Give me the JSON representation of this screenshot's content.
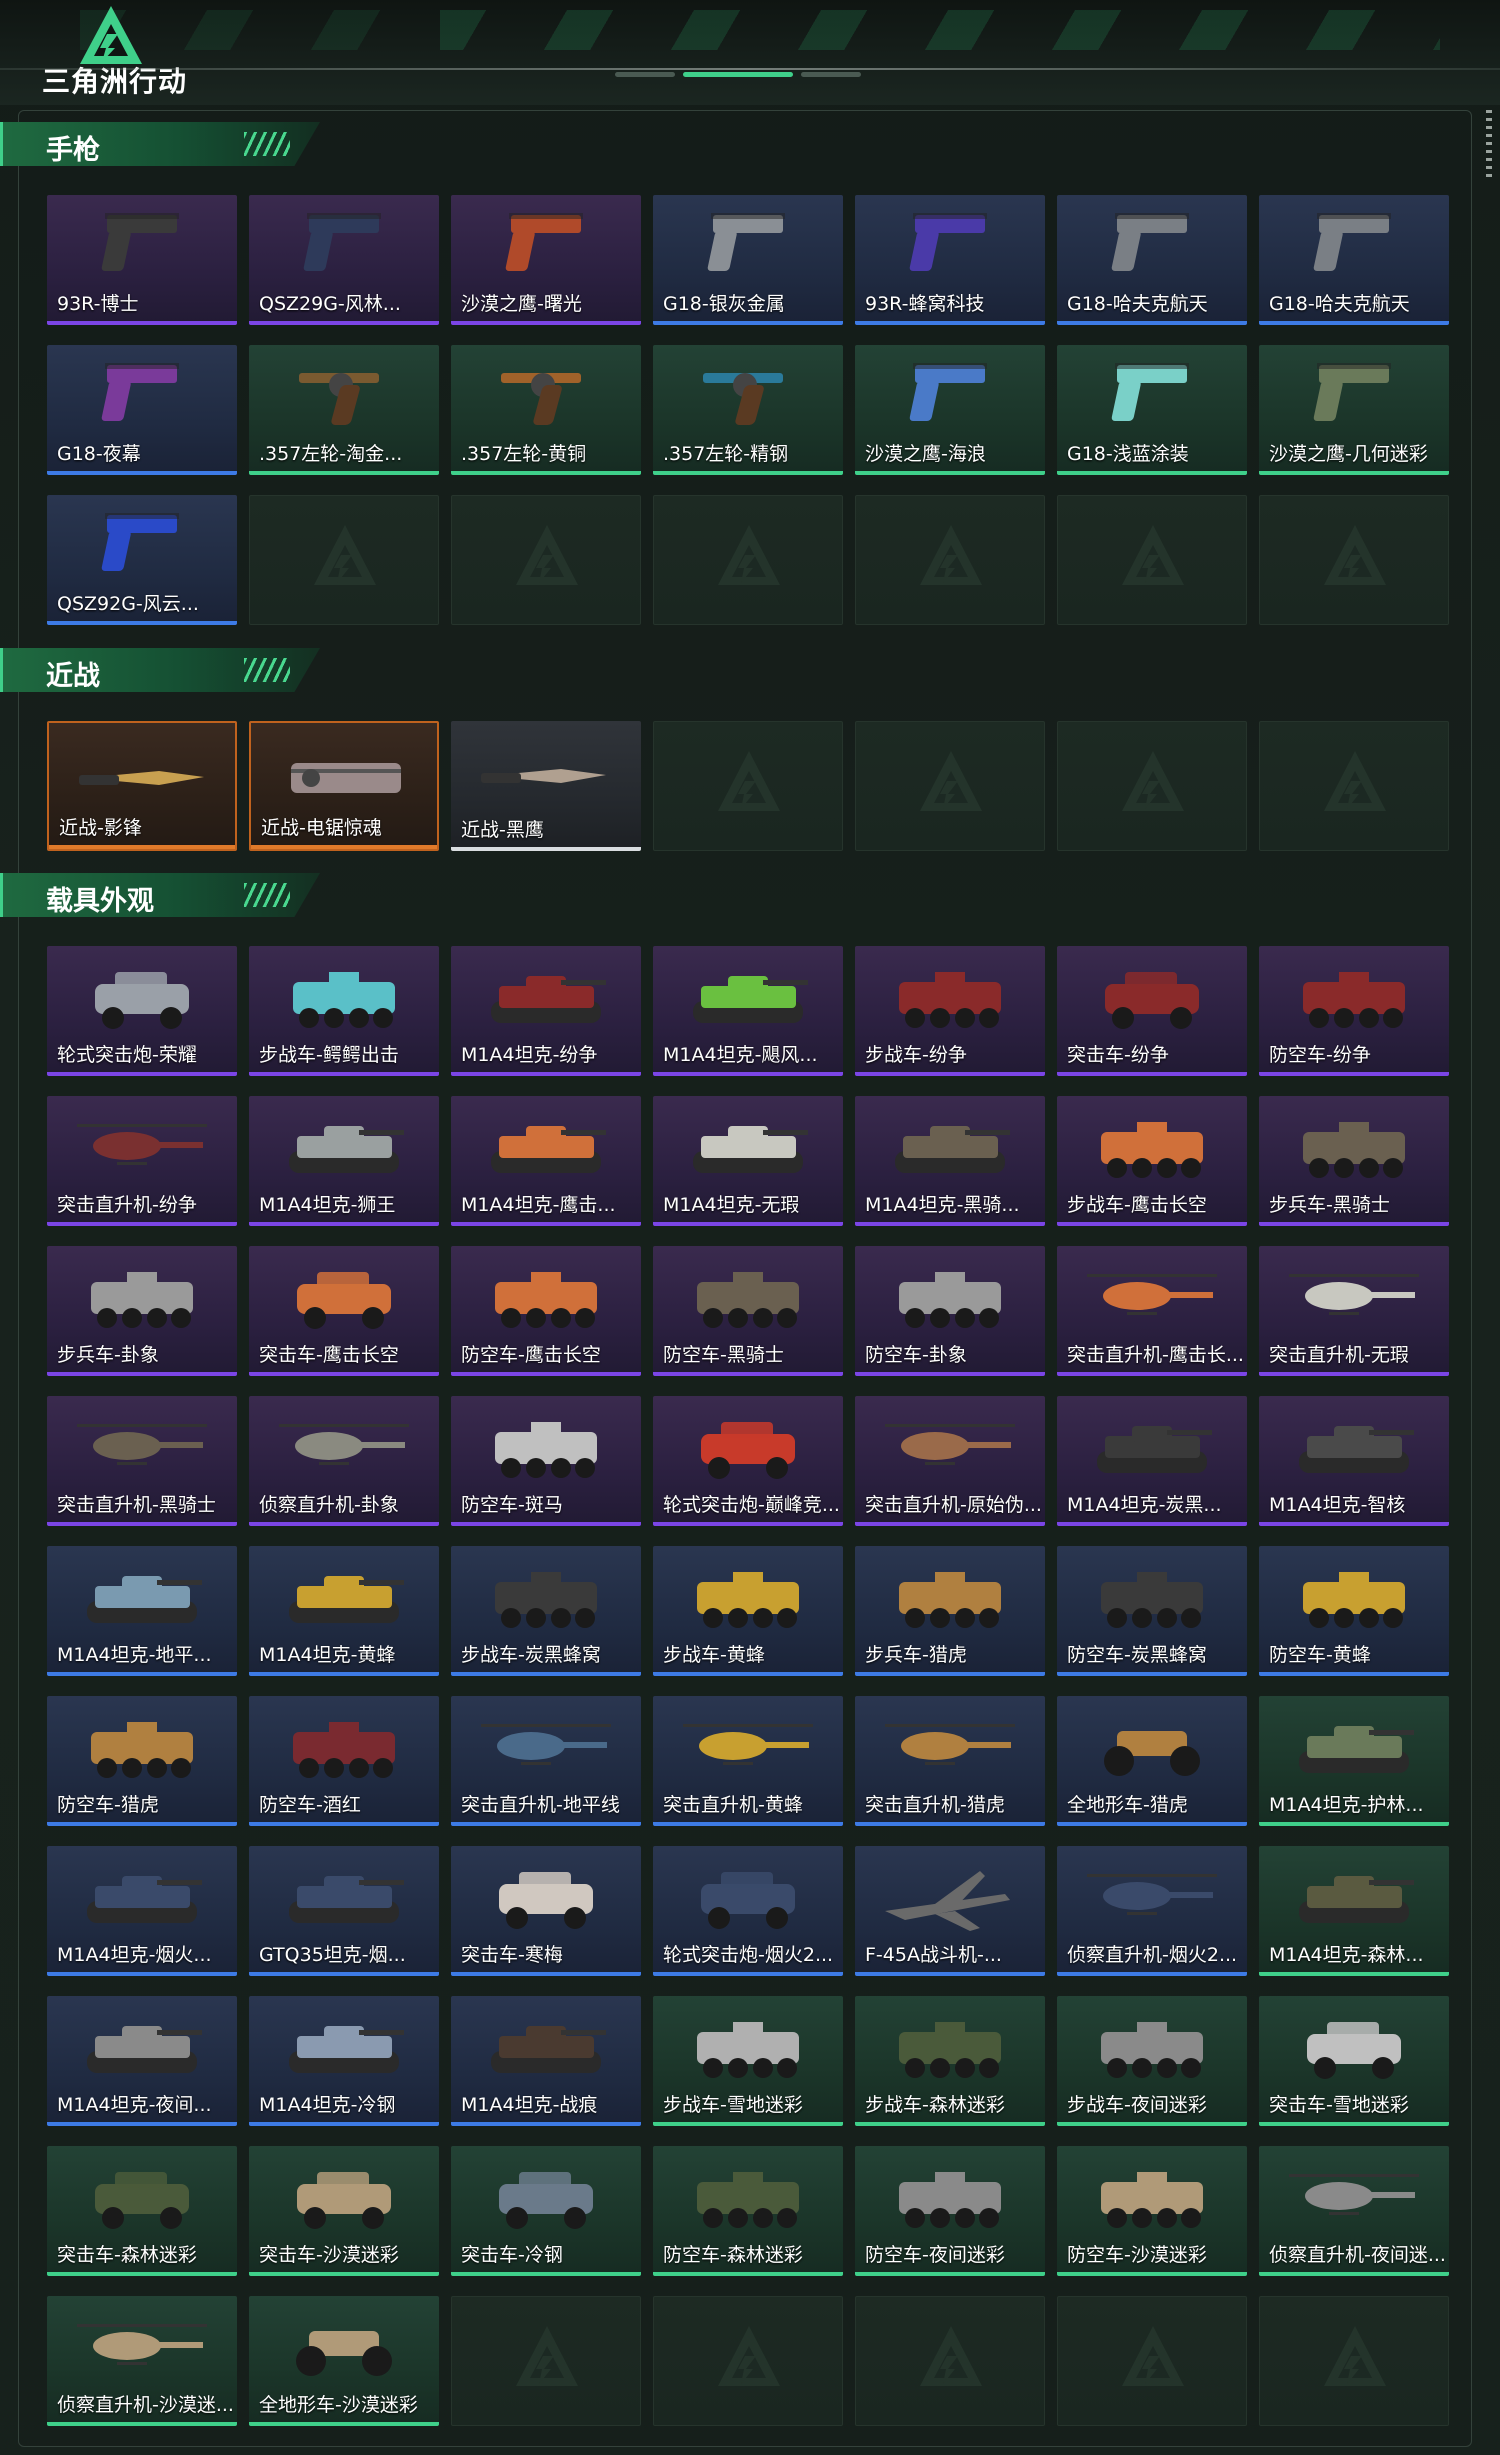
{
  "header": {
    "logo_text": "三角洲行动"
  },
  "sections": [
    {
      "key": "pistol",
      "title": "手枪",
      "items": [
        {
          "name": "93R-博士",
          "rarity": "purple",
          "art": "pistol",
          "color": "#3a3a3a"
        },
        {
          "name": "QSZ29G-风林...",
          "rarity": "purple",
          "art": "pistol",
          "color": "#2e3a5a"
        },
        {
          "name": "沙漠之鹰-曙光",
          "rarity": "purple",
          "art": "pistol",
          "color": "#b04a2a"
        },
        {
          "name": "G18-银灰金属",
          "rarity": "blue",
          "art": "pistol",
          "color": "#8a8f95"
        },
        {
          "name": "93R-蜂窝科技",
          "rarity": "blue",
          "art": "pistol",
          "color": "#4a3aa8"
        },
        {
          "name": "G18-哈夫克航天",
          "rarity": "blue",
          "art": "pistol",
          "color": "#7a7f85"
        },
        {
          "name": "G18-哈夫克航天",
          "rarity": "blue",
          "art": "pistol",
          "color": "#7a7f85"
        },
        {
          "name": "G18-夜幕",
          "rarity": "blue",
          "art": "pistol",
          "color": "#7a3a9a"
        },
        {
          "name": ".357左轮-淘金...",
          "rarity": "green",
          "art": "revolver",
          "color": "#7a5a30"
        },
        {
          "name": ".357左轮-黄铜",
          "rarity": "green",
          "art": "revolver",
          "color": "#a0622a"
        },
        {
          "name": ".357左轮-精钢",
          "rarity": "green",
          "art": "revolver",
          "color": "#2a7a9a"
        },
        {
          "name": "沙漠之鹰-海浪",
          "rarity": "green",
          "art": "pistol",
          "color": "#4a7ac8"
        },
        {
          "name": "G18-浅蓝涂装",
          "rarity": "green",
          "art": "pistol",
          "color": "#7ad0c8"
        },
        {
          "name": "沙漠之鹰-几何迷彩",
          "rarity": "green",
          "art": "pistol",
          "color": "#6a7a5a"
        },
        {
          "name": "QSZ92G-风云...",
          "rarity": "blue",
          "art": "pistol",
          "color": "#2a4ac8"
        },
        {
          "empty": true
        },
        {
          "empty": true
        },
        {
          "empty": true
        },
        {
          "empty": true
        },
        {
          "empty": true
        },
        {
          "empty": true
        }
      ]
    },
    {
      "key": "melee",
      "title": "近战",
      "items": [
        {
          "name": "近战-影锋",
          "rarity": "orange",
          "art": "knife",
          "color": "#c8a050"
        },
        {
          "name": "近战-电锯惊魂",
          "rarity": "orange",
          "art": "saw",
          "color": "#9a8a8a"
        },
        {
          "name": "近战-黑鹰",
          "rarity": "white",
          "art": "knife",
          "color": "#b0a090"
        },
        {
          "empty": true
        },
        {
          "empty": true
        },
        {
          "empty": true
        },
        {
          "empty": true
        }
      ]
    },
    {
      "key": "vehicle",
      "title": "载具外观",
      "items": [
        {
          "name": "轮式突击炮-荣耀",
          "rarity": "purple",
          "art": "car",
          "color": "#9aa0a8"
        },
        {
          "name": "步战车-鳄鳄出击",
          "rarity": "purple",
          "art": "apc",
          "color": "#5ac0c8"
        },
        {
          "name": "M1A4坦克-纷争",
          "rarity": "purple",
          "art": "tank",
          "color": "#8a2a2a"
        },
        {
          "name": "M1A4坦克-飓风...",
          "rarity": "purple",
          "art": "tank",
          "color": "#6ac040"
        },
        {
          "name": "步战车-纷争",
          "rarity": "purple",
          "art": "apc",
          "color": "#8a2a2a"
        },
        {
          "name": "突击车-纷争",
          "rarity": "purple",
          "art": "car",
          "color": "#8a2a2a"
        },
        {
          "name": "防空车-纷争",
          "rarity": "purple",
          "art": "apc",
          "color": "#8a2a2a"
        },
        {
          "name": "突击直升机-纷争",
          "rarity": "purple",
          "art": "heli",
          "color": "#7a3030"
        },
        {
          "name": "M1A4坦克-狮王",
          "rarity": "purple",
          "art": "tank",
          "color": "#9aa0a0"
        },
        {
          "name": "M1A4坦克-鹰击...",
          "rarity": "purple",
          "art": "tank",
          "color": "#d0703a"
        },
        {
          "name": "M1A4坦克-无瑕",
          "rarity": "purple",
          "art": "tank",
          "color": "#c8c8c0"
        },
        {
          "name": "M1A4坦克-黑骑...",
          "rarity": "purple",
          "art": "tank",
          "color": "#6a6050"
        },
        {
          "name": "步战车-鹰击长空",
          "rarity": "purple",
          "art": "apc",
          "color": "#d0703a"
        },
        {
          "name": "步兵车-黑骑士",
          "rarity": "purple",
          "art": "apc",
          "color": "#6a6050"
        },
        {
          "name": "步兵车-卦象",
          "rarity": "purple",
          "art": "apc",
          "color": "#9a9a9a"
        },
        {
          "name": "突击车-鹰击长空",
          "rarity": "purple",
          "art": "car",
          "color": "#d0703a"
        },
        {
          "name": "防空车-鹰击长空",
          "rarity": "purple",
          "art": "apc",
          "color": "#d0703a"
        },
        {
          "name": "防空车-黑骑士",
          "rarity": "purple",
          "art": "apc",
          "color": "#6a6050"
        },
        {
          "name": "防空车-卦象",
          "rarity": "purple",
          "art": "apc",
          "color": "#9a9a9a"
        },
        {
          "name": "突击直升机-鹰击长...",
          "rarity": "purple",
          "art": "heli",
          "color": "#d0703a"
        },
        {
          "name": "突击直升机-无瑕",
          "rarity": "purple",
          "art": "heli",
          "color": "#c8c8c0"
        },
        {
          "name": "突击直升机-黑骑士",
          "rarity": "purple",
          "art": "heli",
          "color": "#6a6050"
        },
        {
          "name": "侦察直升机-卦象",
          "rarity": "purple",
          "art": "heli",
          "color": "#8a8a80"
        },
        {
          "name": "防空车-斑马",
          "rarity": "purple",
          "art": "apc",
          "color": "#c0c0c0"
        },
        {
          "name": "轮式突击炮-巅峰竞...",
          "rarity": "purple",
          "art": "car",
          "color": "#c83a2a"
        },
        {
          "name": "突击直升机-原始伪...",
          "rarity": "purple",
          "art": "heli",
          "color": "#9a6a4a"
        },
        {
          "name": "M1A4坦克-炭黑...",
          "rarity": "purple",
          "art": "tank",
          "color": "#3a3a3a"
        },
        {
          "name": "M1A4坦克-智核",
          "rarity": "purple",
          "art": "tank",
          "color": "#4a4a4a"
        },
        {
          "name": "M1A4坦克-地平...",
          "rarity": "blue",
          "art": "tank",
          "color": "#7a9ab0"
        },
        {
          "name": "M1A4坦克-黄蜂",
          "rarity": "blue",
          "art": "tank",
          "color": "#c8a030"
        },
        {
          "name": "步战车-炭黑蜂窝",
          "rarity": "blue",
          "art": "apc",
          "color": "#3a3a3a"
        },
        {
          "name": "步战车-黄蜂",
          "rarity": "blue",
          "art": "apc",
          "color": "#c8a030"
        },
        {
          "name": "步兵车-猎虎",
          "rarity": "blue",
          "art": "apc",
          "color": "#b08040"
        },
        {
          "name": "防空车-炭黑蜂窝",
          "rarity": "blue",
          "art": "apc",
          "color": "#3a3a3a"
        },
        {
          "name": "防空车-黄蜂",
          "rarity": "blue",
          "art": "apc",
          "color": "#c8a030"
        },
        {
          "name": "防空车-猎虎",
          "rarity": "blue",
          "art": "apc",
          "color": "#b08040"
        },
        {
          "name": "防空车-酒红",
          "rarity": "blue",
          "art": "apc",
          "color": "#7a2a30"
        },
        {
          "name": "突击直升机-地平线",
          "rarity": "blue",
          "art": "heli",
          "color": "#4a6a8a"
        },
        {
          "name": "突击直升机-黄蜂",
          "rarity": "blue",
          "art": "heli",
          "color": "#c8a030"
        },
        {
          "name": "突击直升机-猎虎",
          "rarity": "blue",
          "art": "heli",
          "color": "#b08040"
        },
        {
          "name": "全地形车-猎虎",
          "rarity": "blue",
          "art": "atv",
          "color": "#b08040"
        },
        {
          "name": "M1A4坦克-护林...",
          "rarity": "green",
          "art": "tank",
          "color": "#6a7a5a"
        },
        {
          "name": "M1A4坦克-烟火...",
          "rarity": "blue",
          "art": "tank",
          "color": "#3a4a6a"
        },
        {
          "name": "GTQ35坦克-烟...",
          "rarity": "blue",
          "art": "tank",
          "color": "#3a4a6a"
        },
        {
          "name": "突击车-寒梅",
          "rarity": "blue",
          "art": "car",
          "color": "#d0c8c0"
        },
        {
          "name": "轮式突击炮-烟火2...",
          "rarity": "blue",
          "art": "car",
          "color": "#3a4a6a"
        },
        {
          "name": "F-45A战斗机-...",
          "rarity": "blue",
          "art": "jet",
          "color": "#6a6a6a"
        },
        {
          "name": "侦察直升机-烟火2...",
          "rarity": "blue",
          "art": "heli",
          "color": "#3a4a6a"
        },
        {
          "name": "M1A4坦克-森林...",
          "rarity": "green",
          "art": "tank",
          "color": "#5a5a40"
        },
        {
          "name": "M1A4坦克-夜间...",
          "rarity": "blue",
          "art": "tank",
          "color": "#8a8a8a"
        },
        {
          "name": "M1A4坦克-冷钢",
          "rarity": "blue",
          "art": "tank",
          "color": "#8a9ab0"
        },
        {
          "name": "M1A4坦克-战痕",
          "rarity": "blue",
          "art": "tank",
          "color": "#4a3a30"
        },
        {
          "name": "步战车-雪地迷彩",
          "rarity": "green",
          "art": "apc",
          "color": "#b0b0b0"
        },
        {
          "name": "步战车-森林迷彩",
          "rarity": "green",
          "art": "apc",
          "color": "#4a5a3a"
        },
        {
          "name": "步战车-夜间迷彩",
          "rarity": "green",
          "art": "apc",
          "color": "#8a8a8a"
        },
        {
          "name": "突击车-雪地迷彩",
          "rarity": "green",
          "art": "car",
          "color": "#c0c0c0"
        },
        {
          "name": "突击车-森林迷彩",
          "rarity": "green",
          "art": "car",
          "color": "#4a5a3a"
        },
        {
          "name": "突击车-沙漠迷彩",
          "rarity": "green",
          "art": "car",
          "color": "#b09a78"
        },
        {
          "name": "突击车-冷钢",
          "rarity": "green",
          "art": "car",
          "color": "#6a7a8a"
        },
        {
          "name": "防空车-森林迷彩",
          "rarity": "green",
          "art": "apc",
          "color": "#4a5a3a"
        },
        {
          "name": "防空车-夜间迷彩",
          "rarity": "green",
          "art": "apc",
          "color": "#8a8a8a"
        },
        {
          "name": "防空车-沙漠迷彩",
          "rarity": "green",
          "art": "apc",
          "color": "#b09a78"
        },
        {
          "name": "侦察直升机-夜间迷...",
          "rarity": "green",
          "art": "heli",
          "color": "#8a8a8a"
        },
        {
          "name": "侦察直升机-沙漠迷...",
          "rarity": "green",
          "art": "heli",
          "color": "#b09a78"
        },
        {
          "name": "全地形车-沙漠迷彩",
          "rarity": "green",
          "art": "atv",
          "color": "#b09a78"
        },
        {
          "empty": true
        },
        {
          "empty": true
        },
        {
          "empty": true
        },
        {
          "empty": true
        },
        {
          "empty": true
        }
      ]
    }
  ]
}
